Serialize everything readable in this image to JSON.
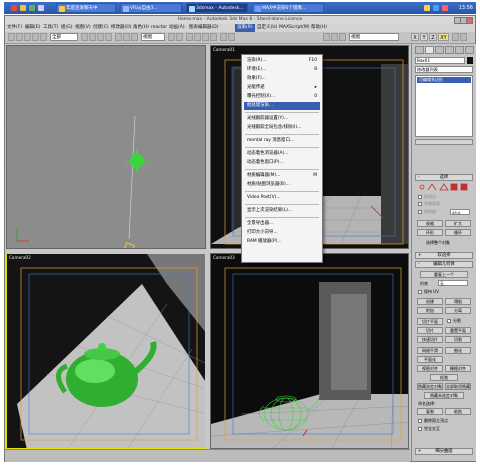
{
  "taskbar": {
    "tasks": [
      "年底宣发聊天中",
      "VRay自由3...",
      "3dsmax - Autodesk...",
      "MAX中渲染6个镜像..."
    ],
    "clock": "13:56"
  },
  "window": {
    "title": "Home.max - Autodesk 3ds Max 8 - Stand-alone Licence"
  },
  "menubar": {
    "items": [
      "文件(F)",
      "编辑(E)",
      "工具(T)",
      "组(G)",
      "视图(V)",
      "创建(C)",
      "修改器(O)",
      "角色(H)",
      "reactor",
      "动画(A)",
      "图表编辑器(D)",
      "渲染(R)",
      "自定义(U)",
      "MAXScript(M)",
      "帮助(H)"
    ]
  },
  "toolbar": {
    "selection_filter": "全部",
    "view_select": "视图",
    "axes": [
      "X",
      "Y",
      "Z",
      "XY"
    ]
  },
  "viewports": {
    "top_left": "",
    "top_right": "Camera01",
    "bottom_left": "Camera02",
    "bottom_right": "Camera03"
  },
  "render_menu": {
    "groups": [
      [
        {
          "label": "渲染(R)...",
          "shortcut": "F10"
        },
        {
          "label": "环境(E)...",
          "shortcut": "8"
        },
        {
          "label": "效果(F)...",
          "shortcut": ""
        },
        {
          "label": "光能传递",
          "shortcut": "▸"
        },
        {
          "label": "曝光控制(X)...",
          "shortcut": "0"
        },
        {
          "label": "批处理渲染...",
          "shortcut": "",
          "highlight": true
        }
      ],
      [
        {
          "label": "光线跟踪器设置(Y)...",
          "shortcut": ""
        },
        {
          "label": "光线跟踪全局包含/排除(I)...",
          "shortcut": ""
        }
      ],
      [
        {
          "label": "mental ray 消息窗口...",
          "shortcut": ""
        }
      ],
      [
        {
          "label": "动态着色浏览器(A)...",
          "shortcut": ""
        },
        {
          "label": "动态着色窗口(P)...",
          "shortcut": ""
        }
      ],
      [
        {
          "label": "材质编辑器(M)...",
          "shortcut": "M"
        },
        {
          "label": "材质/贴图浏览器(B)...",
          "shortcut": ""
        }
      ],
      [
        {
          "label": "Video Post(V)...",
          "shortcut": ""
        }
      ],
      [
        {
          "label": "显示上次渲染结果(L)...",
          "shortcut": ""
        }
      ],
      [
        {
          "label": "全景导出器...",
          "shortcut": ""
        },
        {
          "label": "打印大小向导...",
          "shortcut": ""
        },
        {
          "label": "RAM 播放器(P)...",
          "shortcut": ""
        }
      ]
    ]
  },
  "command_panel": {
    "object_name": "Box01",
    "modifier_list": "修改器列表",
    "stack_item": "可编辑多边形",
    "select_rollout": "选择",
    "by_vertex": "按顶点",
    "ignore_backfacing": "忽略背面",
    "by_angle": "按角度:",
    "angle_value": "45.0",
    "shrink": "收缩",
    "grow": "扩大",
    "ring": "环形",
    "loop": "循环",
    "selected_count": "选择整个对象",
    "soft_selection": "软选择",
    "edit_geometry": "编辑几何体",
    "repeat_last": "重复上一个",
    "constraints": "约束",
    "constraint_value": "无",
    "preserve_uv": "保持 UV",
    "create": "创建",
    "collapse": "塌陷",
    "attach": "附加",
    "detach": "分离",
    "slice_plane": "切片平面",
    "split": "分割",
    "slice": "切片",
    "reset_plane": "重置平面",
    "quickslice": "快速切片",
    "cut": "切割",
    "msmooth": "网格平滑",
    "tessellate": "细化",
    "planarize": "平面化",
    "view_align": "视图对齐",
    "grid_align": "栅格对齐",
    "relax": "松弛",
    "hide_selected": "隐藏选定对象",
    "unhide_all": "全部取消隐藏",
    "hide_unselected": "隐藏未选定对象",
    "named_selections": "命名选择:",
    "copy": "复制",
    "paste": "粘贴",
    "delete_isolated": "删除孤立顶点",
    "full_interactivity": "完全交互",
    "subdivision_surface": "细分曲面"
  },
  "colors": {
    "menu_highlight": "#3a5fb0",
    "teapot_green": "#3cd63c",
    "orange_frame": "#e8a030",
    "yellow_active": "#e8e000"
  }
}
